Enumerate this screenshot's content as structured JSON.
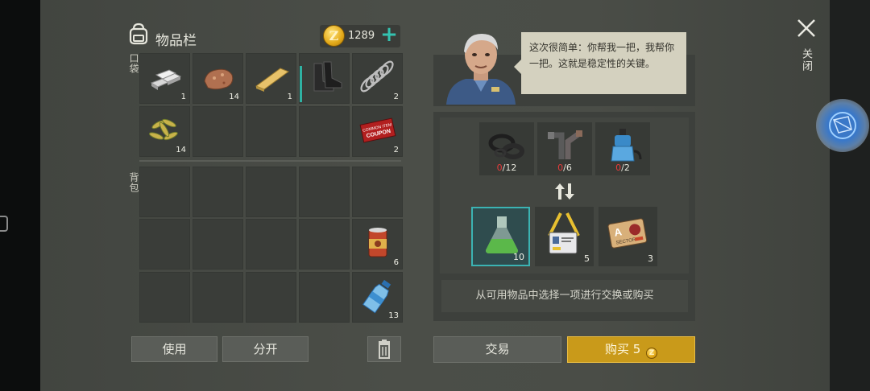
{
  "inventory": {
    "title": "物品栏",
    "coins": "1289",
    "coin_symbol": "Z",
    "pocket_label": "口袋",
    "backpack_label": "背包",
    "slots": [
      {
        "name": "metal-bars",
        "count": "1"
      },
      {
        "name": "copper-ore",
        "count": "14"
      },
      {
        "name": "wood-plank",
        "count": "1"
      },
      {
        "name": "boots",
        "count": ""
      },
      {
        "name": "spring",
        "count": "2"
      },
      {
        "name": "plant-fiber",
        "count": "14"
      },
      {
        "name": "coupon-ticket",
        "count": "2",
        "label_line1": "COMMON ITEM",
        "label_line2": "COUPON"
      },
      {
        "name": "canned-food",
        "count": "6"
      },
      {
        "name": "water-bottle",
        "count": "13"
      }
    ],
    "use_button": "使用",
    "split_button": "分开"
  },
  "trader": {
    "dialog": "这次很简单：你帮我一把，我帮你一把。这就是稳定性的关键。",
    "required": [
      {
        "name": "rubber-seals",
        "have": "0",
        "need": "/12"
      },
      {
        "name": "pipes",
        "have": "0",
        "need": "/6"
      },
      {
        "name": "water-pump",
        "have": "0",
        "need": "/2"
      }
    ],
    "offers": [
      {
        "name": "chemical-flask",
        "count": "10",
        "selected": true
      },
      {
        "name": "id-badge",
        "count": "5"
      },
      {
        "name": "sector-a-keycard",
        "count": "3",
        "card_letter": "A",
        "card_text": "SECTOR"
      }
    ],
    "hint": "从可用物品中选择一项进行交换或购买",
    "trade_button": "交易",
    "buy_label": "购买",
    "buy_price": "5"
  },
  "close_label": "关闭",
  "colors": {
    "accent_teal": "#2fb2a3",
    "gold": "#c99a1a",
    "required_red": "#e43b3b"
  }
}
